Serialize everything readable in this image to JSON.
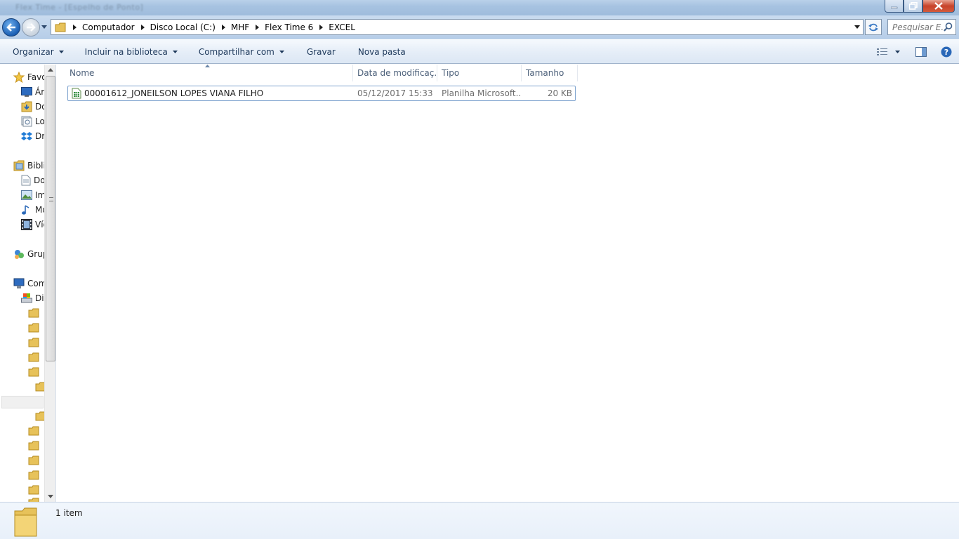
{
  "window": {
    "title_blurred": "Flex Time - [Espelho de Ponto]"
  },
  "address": {
    "crumbs": [
      "Computador",
      "Disco Local (C:)",
      "MHF",
      "Flex Time 6",
      "EXCEL"
    ]
  },
  "search": {
    "placeholder": "Pesquisar E..."
  },
  "toolbar": {
    "organize": "Organizar",
    "include_library": "Incluir na biblioteca",
    "share_with": "Compartilhar com",
    "burn": "Gravar",
    "new_folder": "Nova pasta"
  },
  "navpane": {
    "favorites": "Favoritos",
    "fav_items": [
      "Área de Trabalho",
      "Downloads",
      "Locais",
      "Dropbox"
    ],
    "libraries": "Bibliotecas",
    "lib_items": [
      "Documentos",
      "Imagens",
      "Músicas",
      "Vídeos"
    ],
    "homegroup": "Grupo Doméstico",
    "computer": "Computador",
    "disk": "Disco Local (C:)"
  },
  "columns": {
    "name": "Nome",
    "date": "Data de modificaç...",
    "type": "Tipo",
    "size": "Tamanho"
  },
  "files": [
    {
      "name": "00001612_JONEILSON LOPES VIANA FILHO",
      "date": "05/12/2017 15:33",
      "type": "Planilha Microsoft...",
      "size": "20 KB",
      "icon": "excel-spreadsheet-icon"
    }
  ],
  "status": {
    "item_count": "1 item"
  },
  "colors": {
    "accent": "#1b5fb4",
    "command_text": "#1e395b",
    "selection_border": "#7da2ce"
  }
}
